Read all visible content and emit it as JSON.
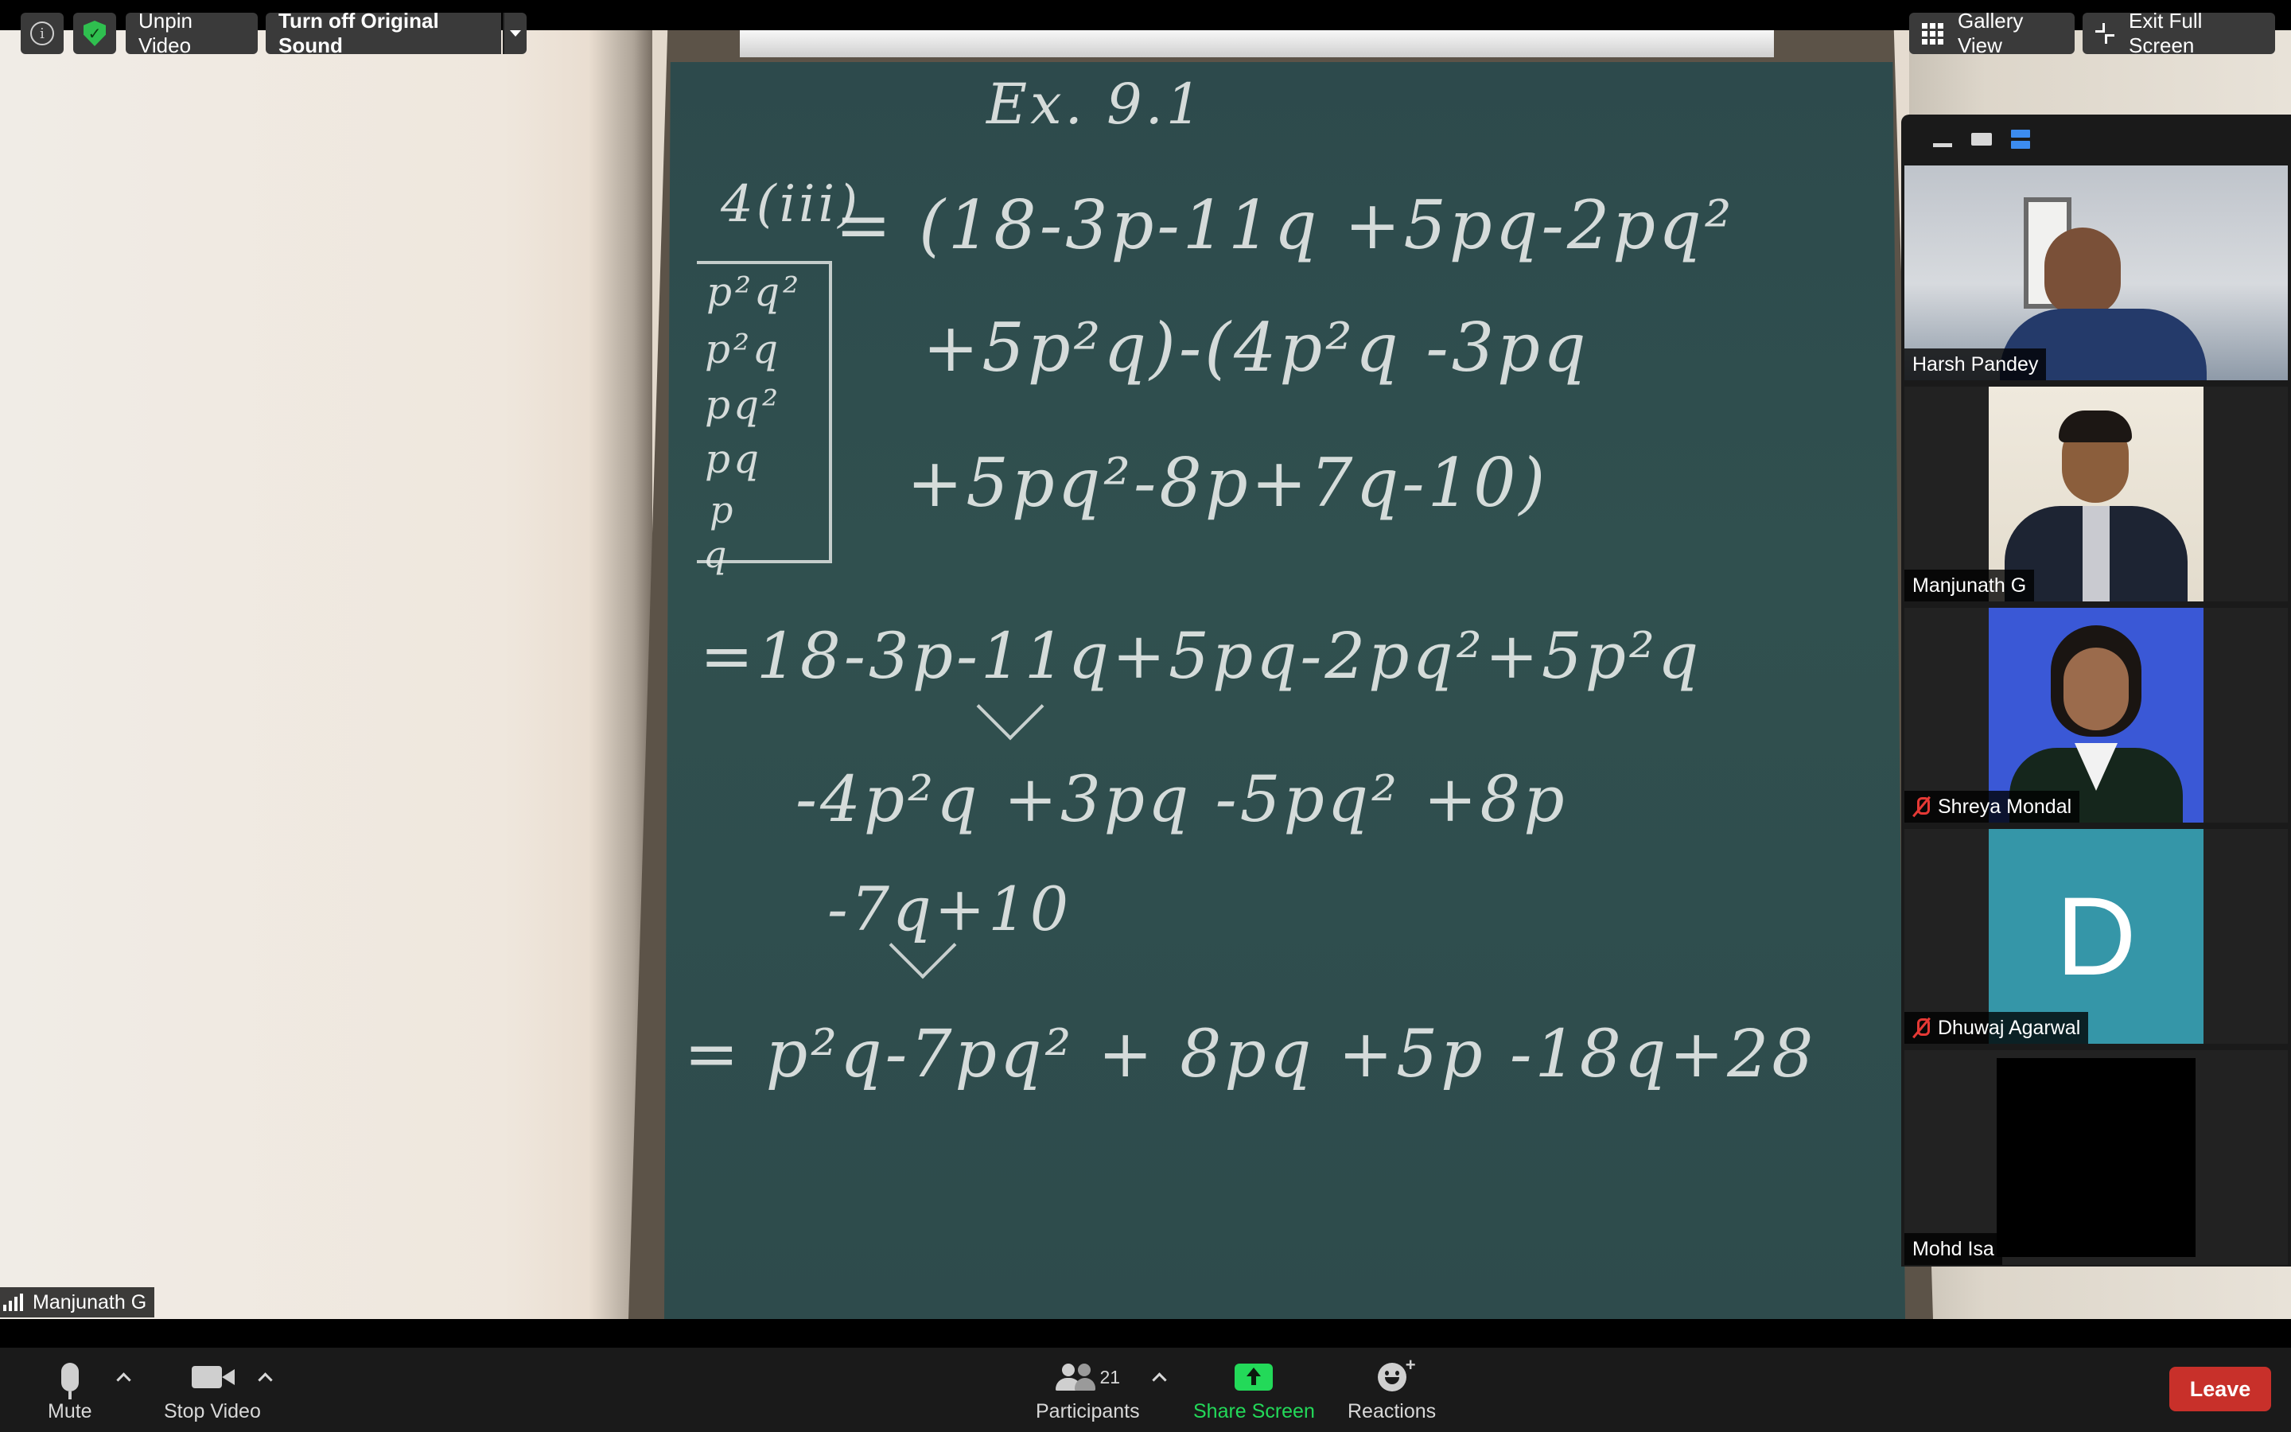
{
  "top_bar": {
    "unpin_video": "Unpin Video",
    "turn_off_original_sound": "Turn off Original Sound",
    "gallery_view": "Gallery View",
    "exit_full_screen": "Exit Full Screen",
    "info_icon": "i",
    "icons": [
      "info-icon",
      "shield-check-icon",
      "chevron-down-icon",
      "grid-icon",
      "exit-fullscreen-icon"
    ],
    "colors": {
      "shield": "#2fbf4f"
    }
  },
  "main_video": {
    "speaker_name": "Manjunath G",
    "board_lines": [
      "Ex. 9.1",
      "4(iii)",
      "= (18-3p-11q +5pq-2pq²",
      "+5p²q)-(4p²q -3pq",
      "+5pq²-8p+7q-10)",
      "=18-3p-11q+5pq-2pq²+5p²q",
      "-4p²q +3pq -5pq² +8p",
      "-7q+10",
      "= p²q-7pq² + 8pq +5p -18q+28"
    ],
    "box_terms": [
      "p²q²",
      "p²q",
      "pq²",
      "pq",
      "p",
      "q"
    ]
  },
  "participants_panel": {
    "view_icons": [
      "minimize-icon",
      "strip-view-icon",
      "stack-view-icon"
    ],
    "tiles": [
      {
        "name": "Harsh Pandey",
        "muted": false
      },
      {
        "name": "Manjunath G",
        "muted": false
      },
      {
        "name": "Shreya Mondal",
        "muted": true
      },
      {
        "name": "Dhuwaj Agarwal",
        "muted": true,
        "avatar_letter": "D",
        "avatar_color": "#3596a8"
      },
      {
        "name": "Mohd Isa",
        "muted": false
      }
    ]
  },
  "toolbar": {
    "mute": "Mute",
    "stop_video": "Stop Video",
    "participants": "Participants",
    "participant_count": "21",
    "share_screen": "Share Screen",
    "reactions": "Reactions",
    "leave": "Leave",
    "colors": {
      "share": "#23d959",
      "leave": "#c8302a"
    }
  }
}
